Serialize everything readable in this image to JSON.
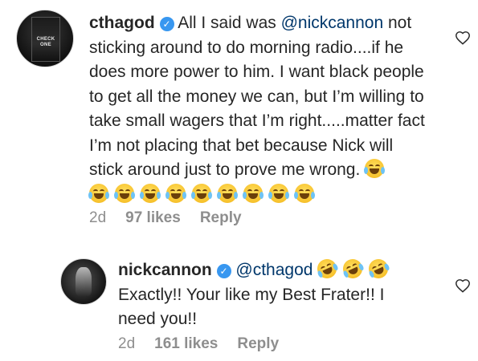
{
  "comments": [
    {
      "username": "cthagod",
      "text_before_mention": "All I said was ",
      "mention": "@nickcannon",
      "text_after_mention": " not sticking around to do morning radio....if he does more power to him. I want black people to get all the money we can, but I’m willing to take small wagers that I’m right.....matter fact I’m not placing that bet because Nick will stick around just to prove me wrong.",
      "emoji_trailing": "face-with-tears-of-joy",
      "emoji_row": [
        "face-with-tears-of-joy",
        "face-with-tears-of-joy",
        "face-with-tears-of-joy",
        "face-with-tears-of-joy",
        "face-with-tears-of-joy",
        "face-with-tears-of-joy",
        "face-with-tears-of-joy",
        "face-with-tears-of-joy",
        "face-with-tears-of-joy"
      ],
      "time": "2d",
      "likes": "97 likes",
      "reply": "Reply",
      "avatar_text": "CHECK ONE"
    },
    {
      "username": "nickcannon",
      "mention": "@cthagod",
      "emojis": [
        "rolling-on-floor-laughing",
        "rolling-on-floor-laughing",
        "rolling-on-floor-laughing"
      ],
      "text": "Exactly!! Your like my Best Frater!! I need you!!",
      "time": "2d",
      "likes": "161 likes",
      "reply": "Reply"
    }
  ],
  "icons": {
    "verified": "verified-badge-icon",
    "like": "heart-outline-icon"
  },
  "colors": {
    "verified": "#3897f0",
    "mention": "#00376b",
    "meta": "#8e8e8e"
  }
}
